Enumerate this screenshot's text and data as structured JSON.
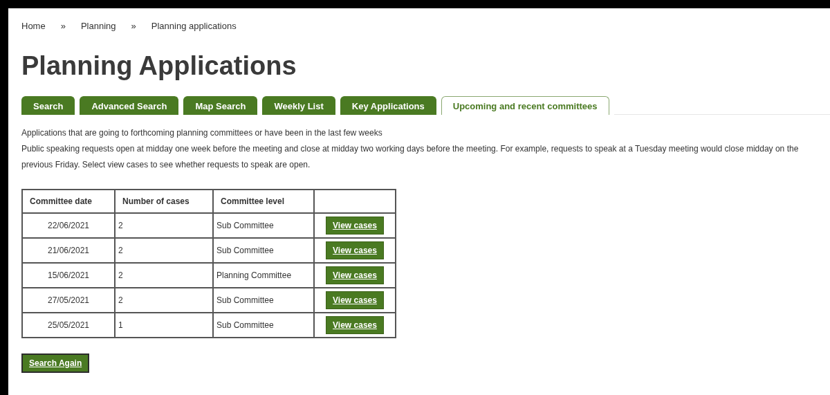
{
  "breadcrumb": [
    {
      "label": "Home",
      "separator": "»"
    },
    {
      "label": "Planning",
      "separator": "»"
    },
    {
      "label": "Planning applications"
    }
  ],
  "title": "Planning Applications",
  "tabs": [
    {
      "label": "Search",
      "selected": false
    },
    {
      "label": "Advanced Search",
      "selected": false
    },
    {
      "label": "Map Search",
      "selected": false
    },
    {
      "label": "Weekly List",
      "selected": false
    },
    {
      "label": "Key Applications",
      "selected": false
    },
    {
      "label": "Upcoming and recent committees",
      "selected": true
    }
  ],
  "intro": [
    "Applications that are going to forthcoming planning committees or have been in the last few weeks",
    "Public speaking requests open at midday one week before the meeting and close at midday two working days before the meeting. For example, requests to speak at a Tuesday meeting would close midday on the previous Friday. Select view cases to see whether requests to speak are open."
  ],
  "table": {
    "columns": [
      "Committee date",
      "Number of cases",
      "Committee level"
    ],
    "rows": [
      {
        "date": "22/06/2021",
        "cases": "2",
        "level": "Sub Committee",
        "action": "View cases"
      },
      {
        "date": "21/06/2021",
        "cases": "2",
        "level": "Sub Committee",
        "action": "View cases"
      },
      {
        "date": "15/06/2021",
        "cases": "2",
        "level": "Planning Committee",
        "action": "View cases"
      },
      {
        "date": "27/05/2021",
        "cases": "2",
        "level": "Sub Committee",
        "action": "View cases"
      },
      {
        "date": "25/05/2021",
        "cases": "1",
        "level": "Sub Committee",
        "action": "View cases"
      }
    ]
  },
  "search_again": "Search Again"
}
